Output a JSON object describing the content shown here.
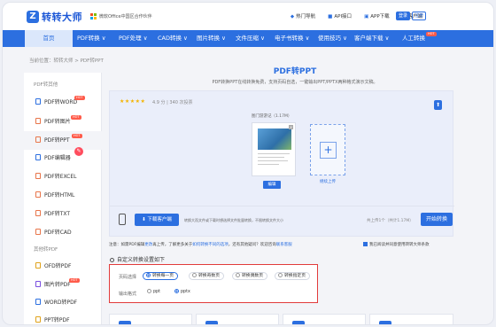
{
  "header": {
    "logo_text": "转转大师",
    "partner_text": "微软Office中国区合作伙伴",
    "links": [
      {
        "icon": "fire-icon",
        "label": "热门导航"
      },
      {
        "icon": "api-icon",
        "label": "API接口"
      },
      {
        "icon": "download-icon",
        "label": "APP下载"
      },
      {
        "icon": "user-icon",
        "label": "客户端"
      }
    ],
    "login_label": "登录",
    "register_label": "注册"
  },
  "nav": {
    "items": [
      {
        "label": "首页"
      },
      {
        "label": "PDF转换 ∨"
      },
      {
        "label": "PDF处理 ∨"
      },
      {
        "label": "CAD转换 ∨"
      },
      {
        "label": "图片转换 ∨"
      },
      {
        "label": "文件压缩 ∨"
      },
      {
        "label": "电子书转换 ∨"
      },
      {
        "label": "使用技巧 ∨"
      },
      {
        "label": "客户端下载 ∨"
      },
      {
        "label": "人工转换"
      }
    ],
    "hot_badge": "HOT"
  },
  "breadcrumb": "当前位置：转转大师 > PDF转PPT",
  "sidebar": {
    "section1_title": "PDF转其他",
    "section1_items": [
      {
        "label": "PDF转WORD",
        "badge": "HOT"
      },
      {
        "label": "PDF转图片",
        "badge": "HOT"
      },
      {
        "label": "PDF转PPT",
        "badge": "HOT"
      },
      {
        "label": "PDF编辑器",
        "badge": ""
      },
      {
        "label": "PDF转EXCEL",
        "badge": ""
      },
      {
        "label": "PDF转HTML",
        "badge": ""
      },
      {
        "label": "PDF转TXT",
        "badge": ""
      },
      {
        "label": "PDF转CAD",
        "badge": ""
      }
    ],
    "section2_title": "其他转PDF",
    "section2_items": [
      {
        "label": "OFD转PDF",
        "badge": ""
      },
      {
        "label": "图片转PDF",
        "badge": "HOT"
      },
      {
        "label": "WORD转PDF",
        "badge": ""
      },
      {
        "label": "PPT转PDF",
        "badge": ""
      }
    ]
  },
  "main": {
    "title": "PDF转PPT",
    "subtitle": "PDF转换PPT在线转换免费，支持页码自选，一键输出PPT/PPTX两种格式演示文稿。",
    "rating_stars": "★★★★★",
    "rating_text": "4.9 分 | 340 次投票",
    "file_name": "图门游游记（1.17M）",
    "edit_label": "编辑",
    "add_label": "继续上传",
    "download_label": "下载客户端",
    "download_note": "转换大而文件或下载时想选择文件批量转换，不限转换文件大小",
    "file_count": "共上传1个（共计1.17M）",
    "start_label": "开始转换"
  },
  "notice": {
    "prefix": "注意：如需PDF编辑",
    "link1": "更改",
    "middle": "再上传，了解更多关于",
    "link2": "如何转换不同的选项",
    "suffix": "，还有其他疑问？欢迎咨询",
    "link3": "联系客服",
    "agree_text": "我已阅读并同意使用转转大师条款"
  },
  "options": {
    "section_title": "自定义转换设置如下",
    "page_label": "页码选择",
    "page_options": [
      {
        "label": "转换每一页",
        "selected": true
      },
      {
        "label": "转换奇数页",
        "selected": false
      },
      {
        "label": "转换偶数页",
        "selected": false
      },
      {
        "label": "转换指定页",
        "selected": false
      }
    ],
    "format_label": "输出格式",
    "format_options": [
      {
        "label": "ppt",
        "selected": false
      },
      {
        "label": "pptx",
        "selected": true
      }
    ]
  },
  "colors": {
    "brand": "#2c6fe0",
    "hot": "#ff5b4a",
    "highlight_border": "#e23b3b"
  }
}
